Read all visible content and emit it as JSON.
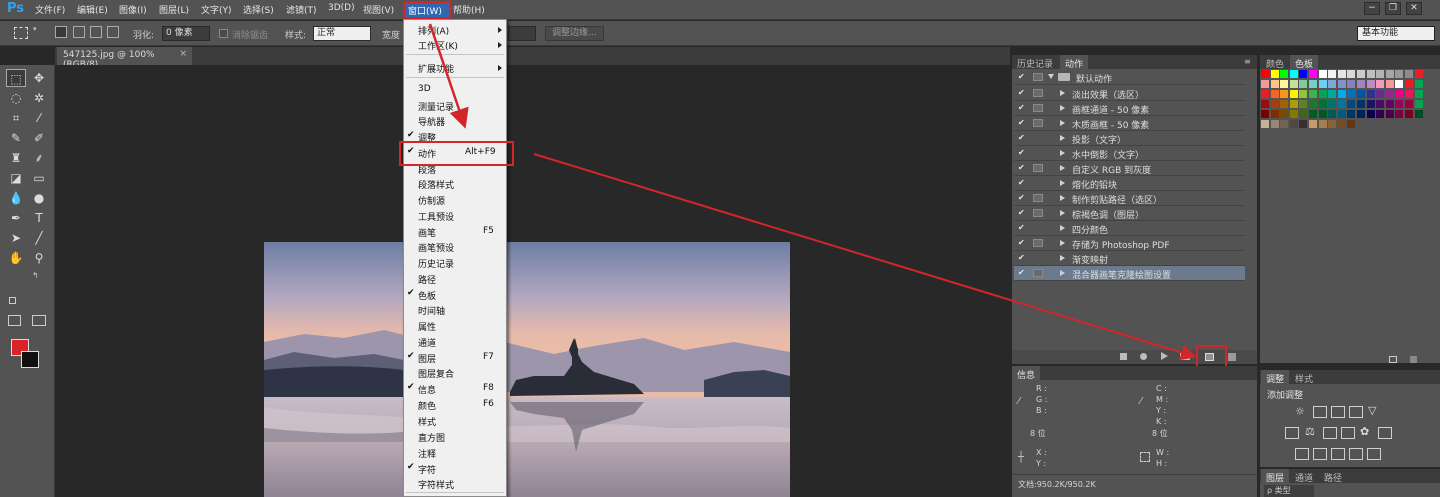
{
  "menubar": {
    "logo": "Ps",
    "items": [
      "文件(F)",
      "编辑(E)",
      "图像(I)",
      "图层(L)",
      "文字(Y)",
      "选择(S)",
      "滤镜(T)",
      "3D(D)",
      "视图(V)"
    ],
    "window": "窗口(W)",
    "help": "帮助(H)",
    "minimize": "−",
    "restore": "❐",
    "close": "✕"
  },
  "options": {
    "feather_label": "羽化:",
    "feather_value": "0 像素",
    "antialias": "消除锯齿",
    "style_label": "样式:",
    "style_value": "正常",
    "width_label": "宽度",
    "adjust_edge": "调整边缘...",
    "workspace": "基本功能"
  },
  "document": {
    "tab": "547125.jpg @ 100%(RGB/8)",
    "close": "×"
  },
  "window_menu": {
    "items": [
      {
        "label": "排列(A)",
        "submenu": true
      },
      {
        "label": "工作区(K)",
        "submenu": true
      },
      {
        "label": "扩展功能",
        "submenu": true
      },
      {
        "label": "3D"
      },
      {
        "label": "测量记录"
      },
      {
        "label": "导航器"
      },
      {
        "label": "调整",
        "checked": true
      },
      {
        "label": "动作",
        "checked": true,
        "shortcut": "Alt+F9"
      },
      {
        "label": "段落"
      },
      {
        "label": "段落样式"
      },
      {
        "label": "仿制源"
      },
      {
        "label": "工具预设"
      },
      {
        "label": "画笔",
        "shortcut": "F5"
      },
      {
        "label": "画笔预设"
      },
      {
        "label": "历史记录"
      },
      {
        "label": "路径"
      },
      {
        "label": "色板",
        "checked": true
      },
      {
        "label": "时间轴"
      },
      {
        "label": "属性"
      },
      {
        "label": "通道"
      },
      {
        "label": "图层",
        "checked": true,
        "shortcut": "F7"
      },
      {
        "label": "图层复合"
      },
      {
        "label": "信息",
        "checked": true,
        "shortcut": "F8"
      },
      {
        "label": "颜色",
        "shortcut": "F6"
      },
      {
        "label": "样式"
      },
      {
        "label": "直方图"
      },
      {
        "label": "注释"
      },
      {
        "label": "字符",
        "checked": true
      },
      {
        "label": "字符样式"
      }
    ]
  },
  "actions_panel": {
    "tabs": [
      "历史记录",
      "动作"
    ],
    "set_name": "默认动作",
    "actions": [
      "淡出效果（选区）",
      "画框通道 - 50 像素",
      "木质画框 - 50 像素",
      "投影（文字）",
      "水中倒影（文字）",
      "自定义 RGB 到灰度",
      "熔化的铅块",
      "制作剪贴路径（选区）",
      "棕褐色调（图层）",
      "四分颜色",
      "存储为 Photoshop PDF",
      "渐变映射",
      "混合器画笔克隆绘图设置"
    ]
  },
  "swatches_panel": {
    "tabs": [
      "颜色",
      "色板"
    ],
    "rows": [
      [
        "#ff0000",
        "#ffff00",
        "#00ff00",
        "#00ffff",
        "#0000ff",
        "#ff00ff",
        "#ffffff",
        "#f2f2f2",
        "#e5e5e5",
        "#d9d9d9",
        "#cccccc",
        "#bfbfbf",
        "#b3b3b3",
        "#a6a6a6",
        "#999999",
        "#8c8c8c",
        "#ed1c24"
      ],
      [
        "#f5989d",
        "#fdc689",
        "#fff799",
        "#c4df9b",
        "#82ca9c",
        "#7accc8",
        "#6dcff6",
        "#7da7d9",
        "#8393ca",
        "#8781bd",
        "#a186be",
        "#bd8cbf",
        "#f49ac1",
        "#f5989d",
        "#ffffff",
        "#ed1c24",
        "#00a651"
      ],
      [
        "#ed1c24",
        "#f26522",
        "#f7941d",
        "#fff200",
        "#8dc63f",
        "#39b54a",
        "#00a651",
        "#00a99d",
        "#00aeef",
        "#0072bc",
        "#0054a6",
        "#2e3192",
        "#662d91",
        "#92278f",
        "#ec008c",
        "#ed145b",
        "#00a651"
      ],
      [
        "#9e0b0f",
        "#a0410d",
        "#a3620a",
        "#aba000",
        "#598527",
        "#197b30",
        "#007236",
        "#00746b",
        "#0076a3",
        "#004a80",
        "#003471",
        "#1b1464",
        "#440e62",
        "#630460",
        "#9e005d",
        "#9e0039",
        "#00a651"
      ],
      [
        "#790000",
        "#7b2e00",
        "#7d4900",
        "#827b00",
        "#406618",
        "#005e20",
        "#005826",
        "#005952",
        "#005b7f",
        "#003663",
        "#002157",
        "#0d004c",
        "#32004b",
        "#4b0049",
        "#7b0046",
        "#7a0026",
        "#004a26"
      ],
      [
        "#c7b299",
        "#998675",
        "#736357",
        "#534741",
        "#37302d",
        "#c69c6d",
        "#a67c52",
        "#8c6239",
        "#754c24",
        "#603913"
      ]
    ]
  },
  "info_panel": {
    "tab": "信息",
    "r": "R :",
    "g": "G :",
    "b": "B :",
    "c": "C :",
    "m": "M :",
    "y": "Y :",
    "k": "K :",
    "bit_left": "8 位",
    "bit_right": "8 位",
    "x": "X :",
    "yy": "Y :",
    "w": "W :",
    "h": "H :",
    "doc": "文档:950.2K/950.2K"
  },
  "adjustments_panel": {
    "tabs": [
      "调整",
      "样式"
    ],
    "title": "添加调整"
  },
  "layers_panel": {
    "tabs": [
      "图层",
      "通道",
      "路径"
    ],
    "filter": "ρ 类型"
  },
  "colors": {
    "accent_red": "#d2262b",
    "foreground": "#d9252a",
    "background": "#111111"
  }
}
